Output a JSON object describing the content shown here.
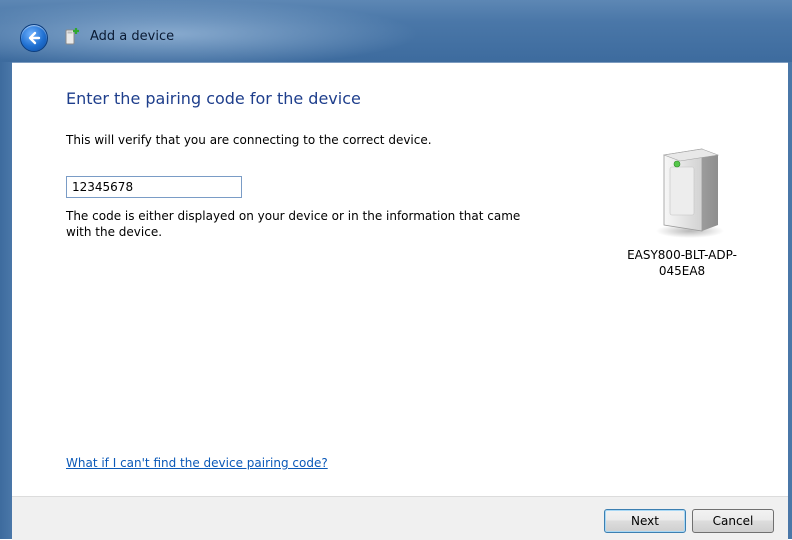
{
  "window": {
    "title": "Add a device",
    "back_icon": "back-arrow-icon",
    "title_icon": "device-wizard-icon"
  },
  "main": {
    "instruction": "Enter the pairing code for the device",
    "subtitle": "This will verify that you are connecting to the correct device.",
    "pairing_code": {
      "value": "12345678",
      "placeholder": ""
    },
    "hint": "The code is either displayed on your device or in the information that came with the device.",
    "help_link": "What if I can't find the device pairing code?"
  },
  "device": {
    "icon": "device-tower-icon",
    "name_line1": "EASY800-BLT-ADP-",
    "name_line2": "045EA8"
  },
  "footer": {
    "next_label": "Next",
    "cancel_label": "Cancel"
  },
  "colors": {
    "titlebar": "#4a77a8",
    "instruction_text": "#1e3e8c",
    "link": "#0b59b8"
  }
}
